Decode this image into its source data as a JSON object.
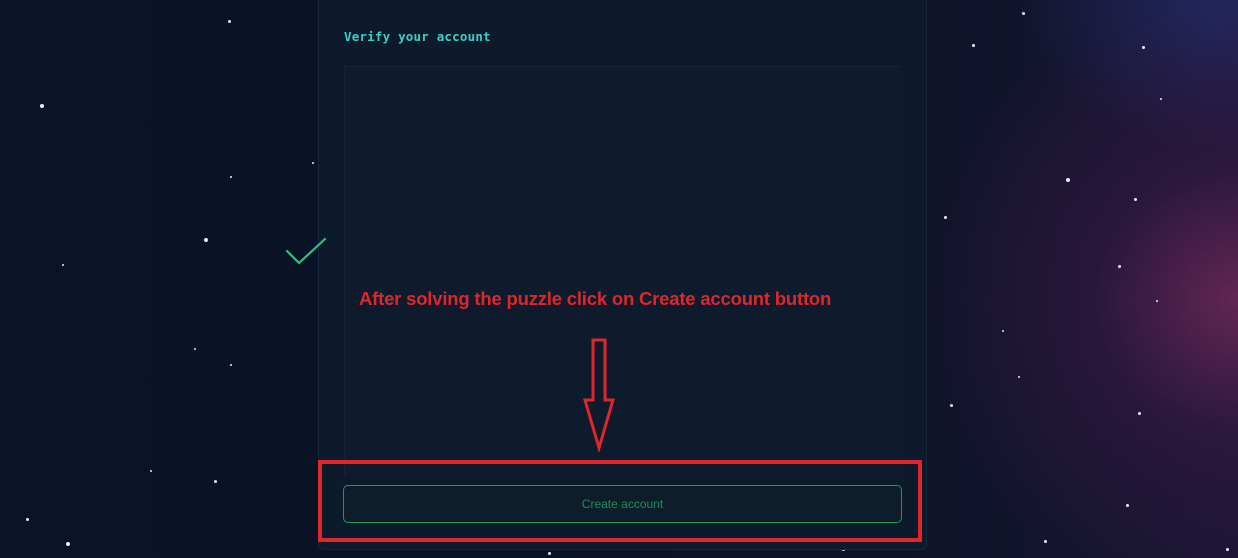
{
  "verify": {
    "title": "Verify your account",
    "status_icon": "check-icon",
    "status_color": "#2ec27e"
  },
  "annotation": {
    "text": "After solving the puzzle click on Create account button",
    "color": "#e0262a",
    "arrow_icon": "arrow-down-outline-icon"
  },
  "actions": {
    "create_account_label": "Create account"
  },
  "colors": {
    "background": "#0b1327",
    "card": "#0d1a2c",
    "accent_title": "#3ad0c7",
    "button_border": "#1f9a55"
  }
}
